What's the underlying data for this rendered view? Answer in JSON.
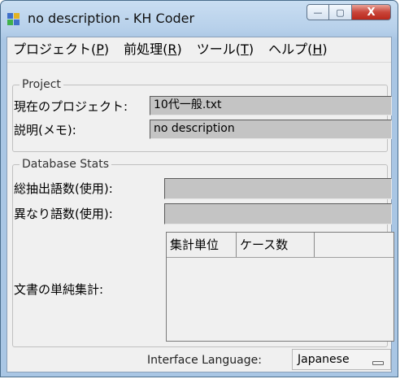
{
  "window": {
    "title": "no description - KH Coder",
    "buttons": {
      "minimize": "—",
      "maximize": "▢",
      "close": "X"
    }
  },
  "menu": [
    {
      "label": "プロジェクト(",
      "accel": "P",
      "suffix": ")"
    },
    {
      "label": "前処理(",
      "accel": "R",
      "suffix": ")"
    },
    {
      "label": "ツール(",
      "accel": "T",
      "suffix": ")"
    },
    {
      "label": "ヘルプ(",
      "accel": "H",
      "suffix": ")"
    }
  ],
  "project": {
    "legend": "Project",
    "current_label": "現在のプロジェクト:",
    "current_value": "10代一般.txt",
    "memo_label": "説明(メモ):",
    "memo_value": "no description"
  },
  "stats": {
    "legend": "Database Stats",
    "total_words_label": "総抽出語数(使用):",
    "total_words_value": "",
    "distinct_words_label": "異なり語数(使用):",
    "distinct_words_value": "",
    "doc_count_label": "文書の単純集計:",
    "table_headers": [
      "集計単位",
      "ケース数"
    ]
  },
  "footer": {
    "interface_language_label": "Interface Language:",
    "interface_language_value": "Japanese"
  },
  "colors": {
    "titlebar": "#b7d0ea",
    "client_bg": "#f0f0f0",
    "field_bg": "#c4c4c4",
    "close_button": "#c9453a"
  }
}
